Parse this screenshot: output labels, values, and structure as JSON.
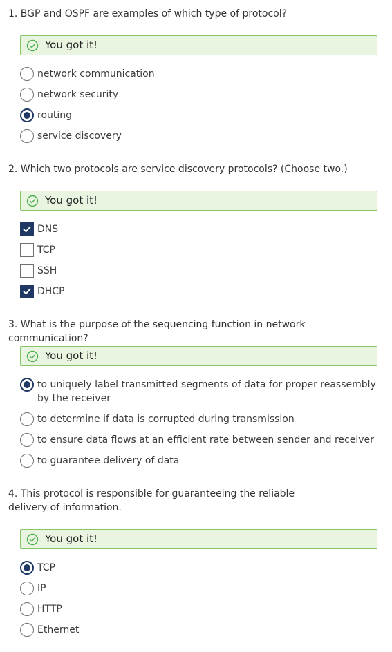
{
  "feedback_text": "You got it!",
  "accent_color": "#1f3864",
  "feedback_color": "#e9f5e1",
  "questions": [
    {
      "text": "1. BGP and OSPF are examples of which type of protocol?",
      "type": "radio",
      "options": [
        {
          "label": "network communication",
          "selected": false
        },
        {
          "label": "network security",
          "selected": false
        },
        {
          "label": "routing",
          "selected": true
        },
        {
          "label": "service discovery",
          "selected": false
        }
      ]
    },
    {
      "text": "2. Which two protocols are service discovery protocols? (Choose two.)",
      "type": "checkbox",
      "options": [
        {
          "label": "DNS",
          "selected": true
        },
        {
          "label": "TCP",
          "selected": false
        },
        {
          "label": "SSH",
          "selected": false
        },
        {
          "label": "DHCP",
          "selected": true
        }
      ]
    },
    {
      "text": "3. What is the purpose of the sequencing function in network communication?",
      "type": "radio",
      "options": [
        {
          "label": "to uniquely label transmitted segments of data for proper reassembly by the receiver",
          "selected": true
        },
        {
          "label": "to determine if data is corrupted during transmission",
          "selected": false
        },
        {
          "label": "to ensure data flows at an efficient rate between sender and receiver",
          "selected": false
        },
        {
          "label": "to guarantee delivery of data",
          "selected": false
        }
      ]
    },
    {
      "text": "4. This protocol is responsible for guaranteeing the reliable delivery of information.",
      "type": "radio",
      "options": [
        {
          "label": "TCP",
          "selected": true
        },
        {
          "label": "IP",
          "selected": false
        },
        {
          "label": "HTTP",
          "selected": false
        },
        {
          "label": "Ethernet",
          "selected": false
        }
      ]
    }
  ]
}
